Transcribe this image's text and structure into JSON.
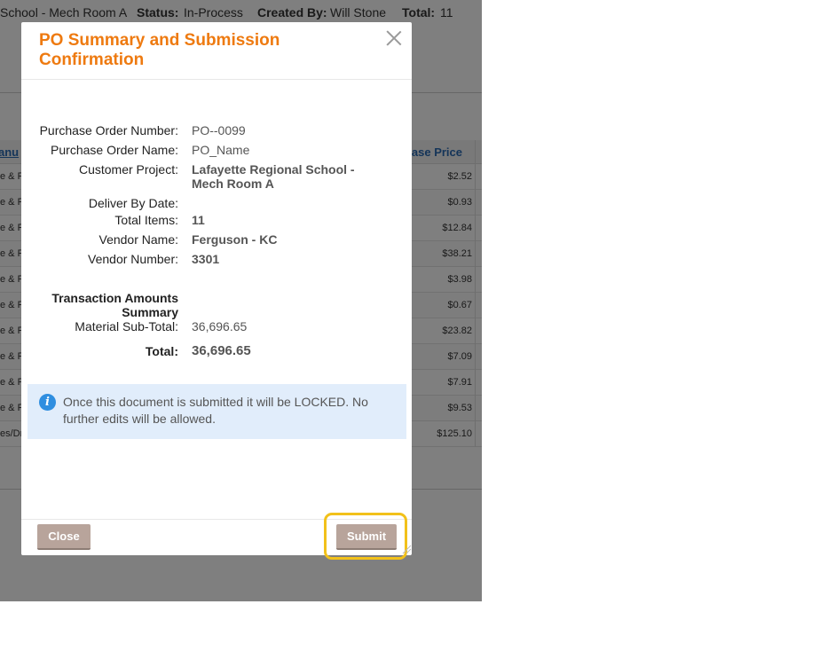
{
  "background": {
    "header": {
      "project_fragment": "School - Mech Room A",
      "status_label": "Status:",
      "status_value": "In-Process",
      "created_by_label": "Created By:",
      "created_by_value": "Will Stone",
      "total_label": "Total:",
      "total_value": "11"
    },
    "table": {
      "col_manufacturer": "anu",
      "col_price": "ase Price",
      "rows": [
        {
          "left": "e & F",
          "price": "$2.52"
        },
        {
          "left": "e & F",
          "price": "$0.93"
        },
        {
          "left": "e & F",
          "price": "$12.84"
        },
        {
          "left": "e & F",
          "price": "$38.21"
        },
        {
          "left": "e & F",
          "price": "$3.98"
        },
        {
          "left": "e & F",
          "price": "$0.67"
        },
        {
          "left": "e & F",
          "price": "$23.82"
        },
        {
          "left": "e & F",
          "price": "$7.09"
        },
        {
          "left": "e & F",
          "price": "$7.91"
        },
        {
          "left": "e & F",
          "price": "$9.53"
        },
        {
          "left": "es/Dr",
          "price": "$125.10"
        }
      ]
    }
  },
  "modal": {
    "title": "PO Summary and Submission Confirmation",
    "fields": {
      "po_number_label": "Purchase Order Number:",
      "po_number_value": "PO--0099",
      "po_name_label": "Purchase Order Name:",
      "po_name_value": "PO_Name",
      "customer_project_label": "Customer Project:",
      "customer_project_value": "Lafayette Regional School - Mech Room A",
      "deliver_by_label": "Deliver By Date:",
      "deliver_by_value": "",
      "total_items_label": "Total Items:",
      "total_items_value": "11",
      "vendor_name_label": "Vendor Name:",
      "vendor_name_value": "Ferguson - KC",
      "vendor_number_label": "Vendor Number:",
      "vendor_number_value": "3301"
    },
    "transaction": {
      "heading_line1": "Transaction Amounts",
      "heading_line2": "Summary",
      "subtotal_label": "Material Sub-Total:",
      "subtotal_value": "36,696.65",
      "total_label": "Total:",
      "total_value": "36,696.65"
    },
    "info_message": "Once this document is submitted it will be LOCKED. No further edits will be allowed.",
    "buttons": {
      "close_label": "Close",
      "submit_label": "Submit"
    },
    "colors": {
      "title": "#ee7a10",
      "button": "#b8a49b",
      "info_bg": "#e1edfb",
      "highlight": "#f2c11a"
    }
  }
}
